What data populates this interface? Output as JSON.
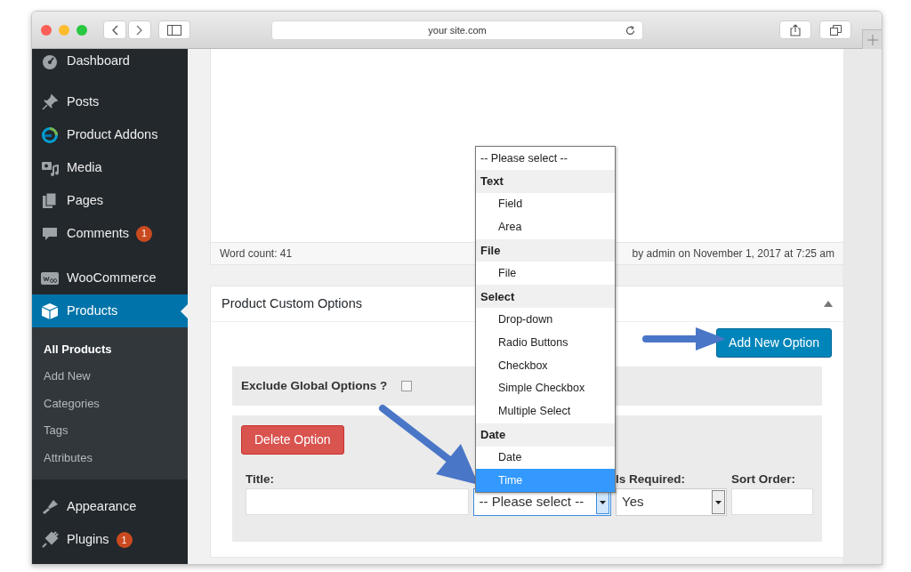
{
  "browser": {
    "url": "your site.com"
  },
  "sidebar": {
    "groups": [
      [
        {
          "label": "Dashboard",
          "selected": false
        }
      ],
      [
        {
          "label": "Posts",
          "selected": false
        },
        {
          "label": "Product Addons",
          "selected": false
        },
        {
          "label": "Media",
          "selected": false
        },
        {
          "label": "Pages",
          "selected": false
        },
        {
          "label": "Comments",
          "selected": false,
          "badge": "1"
        }
      ],
      [
        {
          "label": "WooCommerce",
          "selected": false
        },
        {
          "label": "Products",
          "selected": true,
          "children": [
            {
              "label": "All Products",
              "selected": true
            },
            {
              "label": "Add New",
              "selected": false
            },
            {
              "label": "Categories",
              "selected": false
            },
            {
              "label": "Tags",
              "selected": false
            },
            {
              "label": "Attributes",
              "selected": false
            }
          ]
        }
      ],
      [
        {
          "label": "Appearance",
          "selected": false
        },
        {
          "label": "Plugins",
          "selected": false,
          "badge": "1"
        }
      ]
    ]
  },
  "editor": {
    "word_count": "Word count: 41",
    "last_edited": "by admin on November 1, 2017 at 7:25 am"
  },
  "options_panel": {
    "title": "Product Custom Options",
    "expanded": true,
    "add_button": "Add New Option",
    "exclude_global": {
      "label": "Exclude Global Options ?",
      "checked": false
    },
    "delete_button": "Delete Option",
    "columns": [
      {
        "label": "Title:",
        "kind": "text"
      },
      {
        "kind": "select",
        "value": "-- Please select --",
        "open": true
      },
      {
        "label": "Is Required:",
        "kind": "select",
        "value": "Yes"
      },
      {
        "label": "Sort Order:",
        "kind": "text"
      }
    ],
    "dropdown": [
      {
        "kind": "option",
        "label": "-- Please select --",
        "selected": false
      },
      {
        "kind": "group",
        "label": "Text"
      },
      {
        "kind": "option",
        "label": "Field",
        "selected": false
      },
      {
        "kind": "option",
        "label": "Area",
        "selected": false
      },
      {
        "kind": "group",
        "label": "File"
      },
      {
        "kind": "option",
        "label": "File",
        "selected": false
      },
      {
        "kind": "group",
        "label": "Select"
      },
      {
        "kind": "option",
        "label": "Drop-down",
        "selected": false
      },
      {
        "kind": "option",
        "label": "Radio Buttons",
        "selected": false
      },
      {
        "kind": "option",
        "label": "Checkbox",
        "selected": false
      },
      {
        "kind": "option",
        "label": "Simple Checkbox",
        "selected": false
      },
      {
        "kind": "option",
        "label": "Multiple Select",
        "selected": false
      },
      {
        "kind": "group",
        "label": "Date"
      },
      {
        "kind": "option",
        "label": "Date",
        "selected": false
      },
      {
        "kind": "option",
        "label": "Time",
        "selected": true
      }
    ]
  }
}
